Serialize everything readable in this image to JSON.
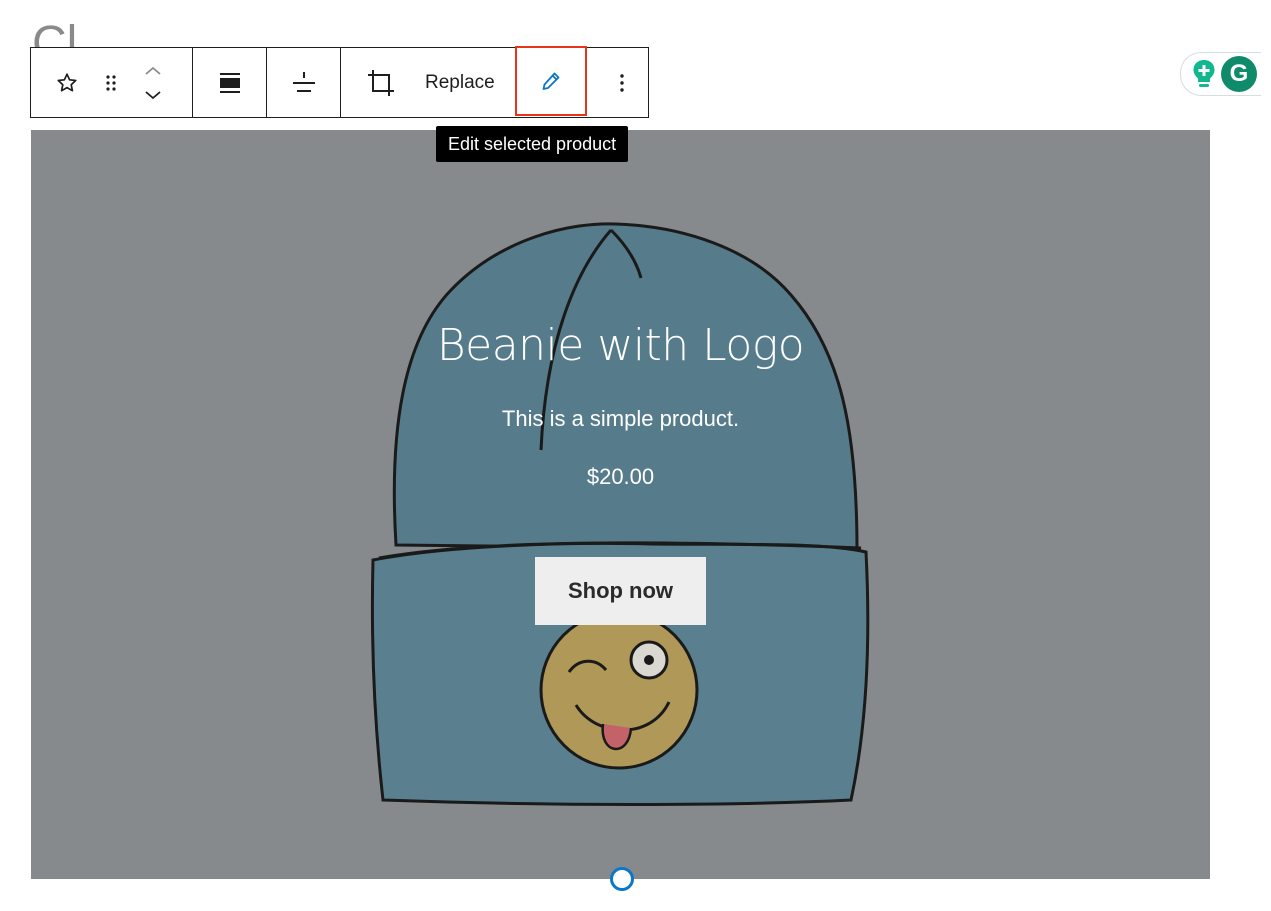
{
  "background": {
    "heading_fragment": "Cl"
  },
  "toolbar": {
    "block_icon": "star-icon",
    "drag_icon": "drag-handle-icon",
    "move_up_icon": "chevron-up-icon",
    "move_down_icon": "chevron-down-icon",
    "cover_layout_icon": "full-height-icon",
    "align_icon": "justify-center-icon",
    "crop_icon": "crop-icon",
    "replace_label": "Replace",
    "edit_icon": "pencil-icon",
    "more_icon": "more-vertical-icon"
  },
  "tooltip": {
    "text": "Edit selected product"
  },
  "product": {
    "title": "Beanie with Logo",
    "description": "This is a simple product.",
    "price": "$20.00",
    "button_label": "Shop now"
  },
  "colors": {
    "overlay": "#868a8d",
    "highlight_border": "#e8341c",
    "accent_blue": "#0a77c8",
    "grammarly_green": "#0f8a6b",
    "beanie_blue": "#567b8a"
  },
  "grammarly": {
    "bulb_icon": "lightbulb-plus-icon",
    "logo_letter": "G"
  }
}
